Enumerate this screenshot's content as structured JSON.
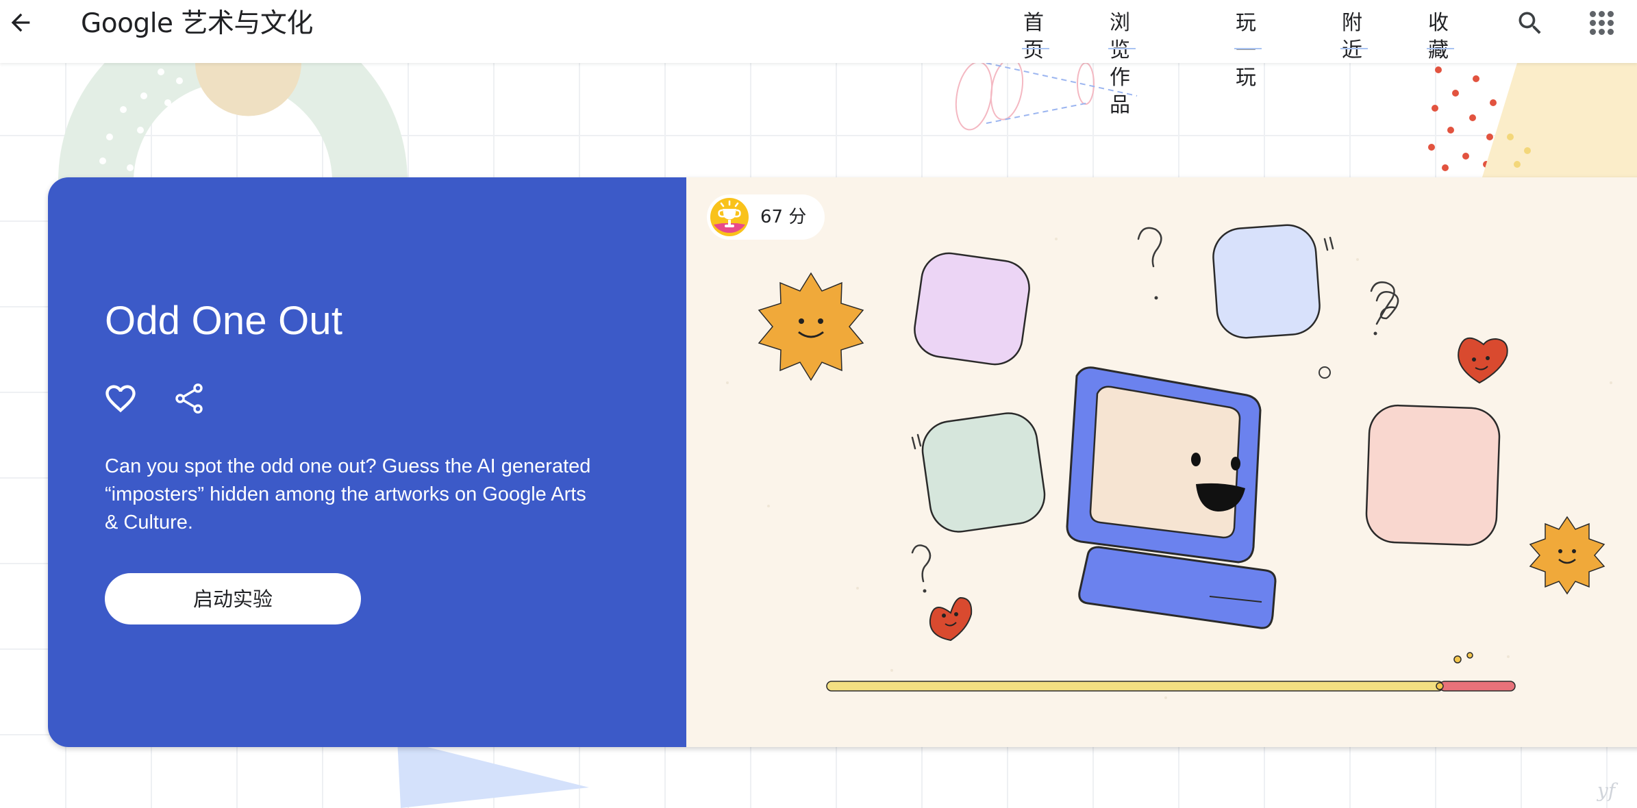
{
  "header": {
    "logo_text": "Google 艺术与文化",
    "nav": [
      "首页",
      "浏览作品",
      "玩一玩",
      "附近",
      "收藏"
    ],
    "icons": {
      "back": "arrow-back-icon",
      "search": "search-icon",
      "apps": "apps-grid-icon"
    }
  },
  "experiment": {
    "title": "Odd One Out",
    "description": "Can you spot the odd one out? Guess the AI generated “imposters” hidden among the artworks on Google Arts & Culture.",
    "launch_label": "启动实验",
    "icons": {
      "like": "heart-outline-icon",
      "share": "share-icon"
    },
    "score": "67 分",
    "score_icon": "trophy-icon"
  },
  "watermark": "yf",
  "colors": {
    "card_blue": "#3c5ac8",
    "illustration_bg": "#fbf4ea",
    "nav_underline": "#a9c3f2"
  }
}
